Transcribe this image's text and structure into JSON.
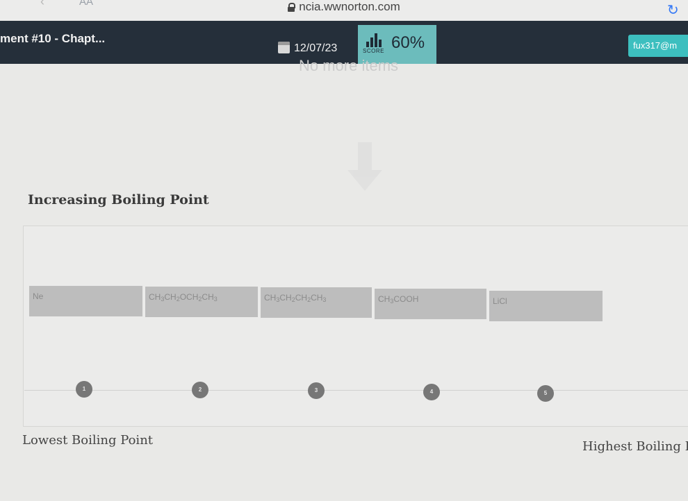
{
  "browser": {
    "reader_label": "AA",
    "url": "ncia.wwnorton.com"
  },
  "header": {
    "assignment_title": "ment #10 - Chapt...",
    "due_date": "12/07/23",
    "score_label": "SCORE",
    "score_value": "60%",
    "user": "fux317@m"
  },
  "content": {
    "ghost_text": "No more items",
    "heading": "Increasing Boiling Point",
    "items": [
      {
        "parts": [
          "Ne"
        ]
      },
      {
        "parts": [
          "CH",
          "3",
          "CH",
          "2",
          "OCH",
          "2",
          "CH",
          "3"
        ]
      },
      {
        "parts": [
          "CH",
          "3",
          "CH",
          "2",
          "CH",
          "2",
          "CH",
          "3"
        ]
      },
      {
        "parts": [
          "CH",
          "3",
          "COOH"
        ]
      },
      {
        "parts": [
          "LiCl"
        ]
      }
    ],
    "slots": [
      "1",
      "2",
      "3",
      "4",
      "5"
    ],
    "low_label": "Lowest Boiling Point",
    "high_label": "Highest Boiling Po"
  },
  "colors": {
    "header_bg": "#252f3a",
    "score_bg": "#6cbcbc",
    "user_bg": "#3dbfbf",
    "item_bg": "#bdbdbd",
    "slot_bg": "#777777"
  },
  "icons": [
    "back-chevron-icon",
    "lock-icon",
    "reload-icon",
    "calendar-icon",
    "score-chart-icon",
    "down-arrow-icon"
  ]
}
